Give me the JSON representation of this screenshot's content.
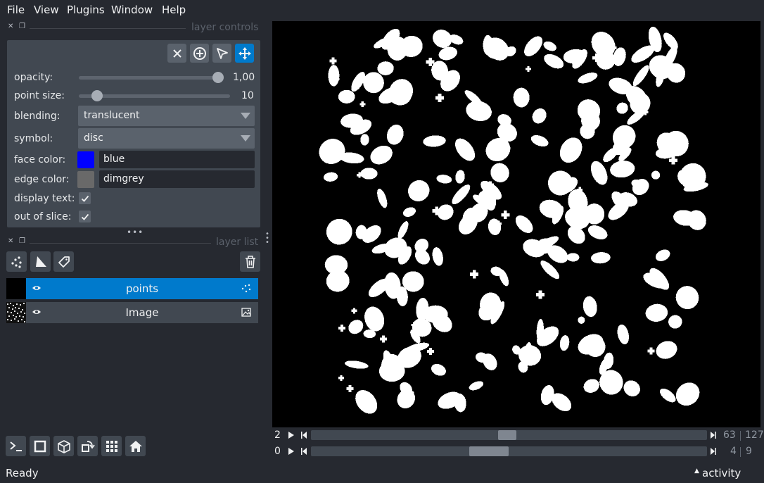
{
  "menu": {
    "items": [
      {
        "label": "File"
      },
      {
        "label": "View"
      },
      {
        "label": "Plugins"
      },
      {
        "label": "Window"
      },
      {
        "label": "Help"
      }
    ]
  },
  "layer_controls": {
    "title": "layer controls",
    "opacity": {
      "label": "opacity:",
      "value": "1,00",
      "fraction": 1.0
    },
    "point_size": {
      "label": "point size:",
      "value": "10",
      "fraction": 0.12
    },
    "blending": {
      "label": "blending:",
      "value": "translucent"
    },
    "symbol": {
      "label": "symbol:",
      "value": "disc"
    },
    "face_color": {
      "label": "face color:",
      "value": "blue",
      "swatch": "#0000ff"
    },
    "edge_color": {
      "label": "edge color:",
      "value": "dimgrey",
      "swatch": "#696969"
    },
    "display_text": {
      "label": "display text:",
      "checked": true
    },
    "out_of_slice": {
      "label": "out of slice:",
      "checked": true
    },
    "mode_buttons": [
      "delete-selected",
      "add-points",
      "select-points",
      "pan-zoom"
    ],
    "active_mode": "pan-zoom"
  },
  "layer_list": {
    "title": "layer list",
    "layers": [
      {
        "name": "points",
        "selected": true,
        "visible": true,
        "type": "points"
      },
      {
        "name": "Image",
        "selected": false,
        "visible": true,
        "type": "image"
      }
    ]
  },
  "dims": [
    {
      "axis": "2",
      "current": "63",
      "max": "127",
      "fraction": 0.5
    },
    {
      "axis": "0",
      "current": "4",
      "max": "9",
      "fraction": 0.44
    }
  ],
  "status": {
    "text": "Ready",
    "activity": "activity"
  },
  "colors": {
    "accent": "#007acc",
    "panel": "#414851",
    "background": "#262930"
  }
}
